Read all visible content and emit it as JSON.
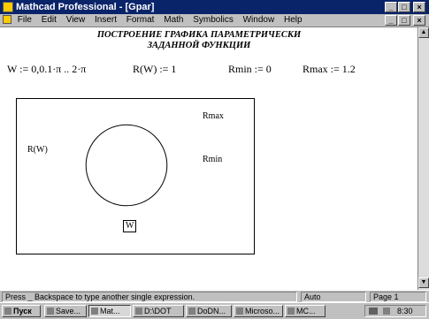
{
  "window": {
    "title": "Mathcad Professional - [Gpar]"
  },
  "menu": {
    "items": [
      "File",
      "Edit",
      "View",
      "Insert",
      "Format",
      "Math",
      "Symbolics",
      "Window",
      "Help"
    ]
  },
  "document": {
    "heading_line1": "ПОСТРОЕНИЕ ГРАФИКА ПАРАМЕТРИЧЕСКИ",
    "heading_line2": "ЗАДАННОЙ ФУНКЦИИ",
    "eq_w": "W := 0,0.1·π .. 2·π",
    "eq_r": "R(W) := 1",
    "eq_rmin": "Rmin := 0",
    "eq_rmax": "Rmax := 1.2"
  },
  "plot": {
    "y_label": "R(W)",
    "x_label": "W",
    "rmax_label": "Rmax",
    "rmin_label": "Rmin"
  },
  "chart_data": {
    "type": "line",
    "polar": true,
    "radius": 1,
    "theta_range": [
      0,
      6.2832
    ],
    "r_range": [
      0,
      1.2
    ],
    "title": "",
    "series": [
      {
        "name": "",
        "r": 1
      }
    ]
  },
  "status": {
    "message": "Press _ Backspace to type another single expression.",
    "mode": "Auto",
    "page": "Page 1"
  },
  "taskbar": {
    "start": "Пуск",
    "buttons": [
      "Save...",
      "Mat...",
      "D:\\DOT",
      "DoDN...",
      "Microso...",
      "MC..."
    ],
    "clock": "8:30"
  }
}
